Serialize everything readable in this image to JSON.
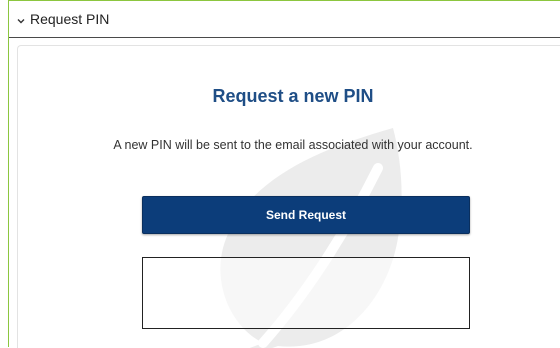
{
  "section": {
    "header_label": "Request PIN",
    "chevron_icon": "chevron-down-icon"
  },
  "panel": {
    "title": "Request a new PIN",
    "description": "A new PIN will be sent to the email associated with your account.",
    "send_button_label": "Send Request",
    "watermark_icon": "leaf-icon"
  },
  "colors": {
    "frame_accent": "#8cc63f",
    "title": "#1f4e86",
    "button_bg": "#0c3d7a",
    "button_text": "#ffffff"
  }
}
